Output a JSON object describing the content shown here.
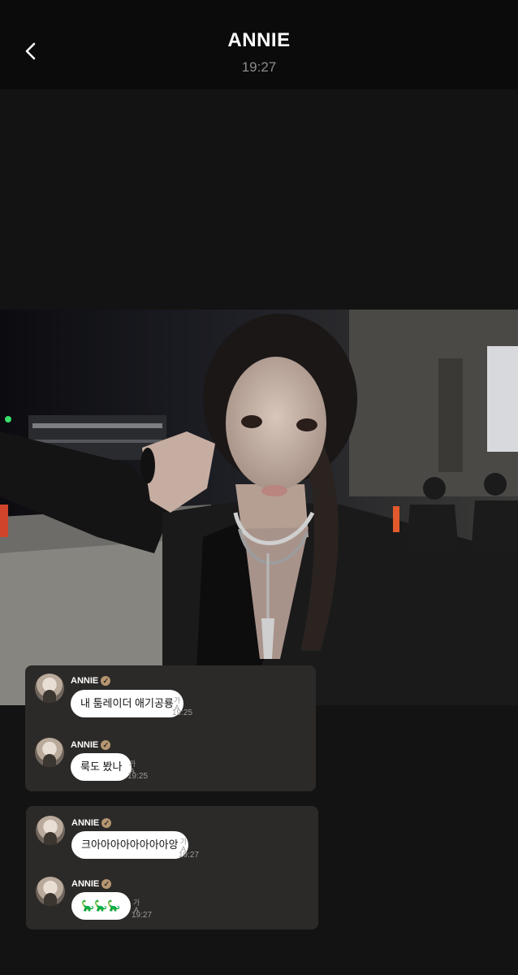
{
  "header": {
    "title": "ANNIE",
    "time": "19:27"
  },
  "photo": {
    "subject": "selfie"
  },
  "cards": [
    {
      "messages": [
        {
          "sender": "ANNIE",
          "text": "내 툼레이더 애기공룡",
          "time": "19:25",
          "translate_icon": "가A"
        },
        {
          "sender": "ANNIE",
          "text": "룩도 봤나",
          "time": "19:25",
          "translate_icon": "가A"
        }
      ]
    },
    {
      "messages": [
        {
          "sender": "ANNIE",
          "text": "크아아아아아아아아앙",
          "time": "19:27",
          "translate_icon": "가A"
        },
        {
          "sender": "ANNIE",
          "text": "🦕🦕🦕",
          "time": "19:27",
          "translate_icon": "가A"
        }
      ]
    }
  ],
  "colors": {
    "background": "#131313",
    "header": "#0b0b0b",
    "card": "#2c2a28",
    "bubble": "#ffffff",
    "verified": "#b59670"
  }
}
